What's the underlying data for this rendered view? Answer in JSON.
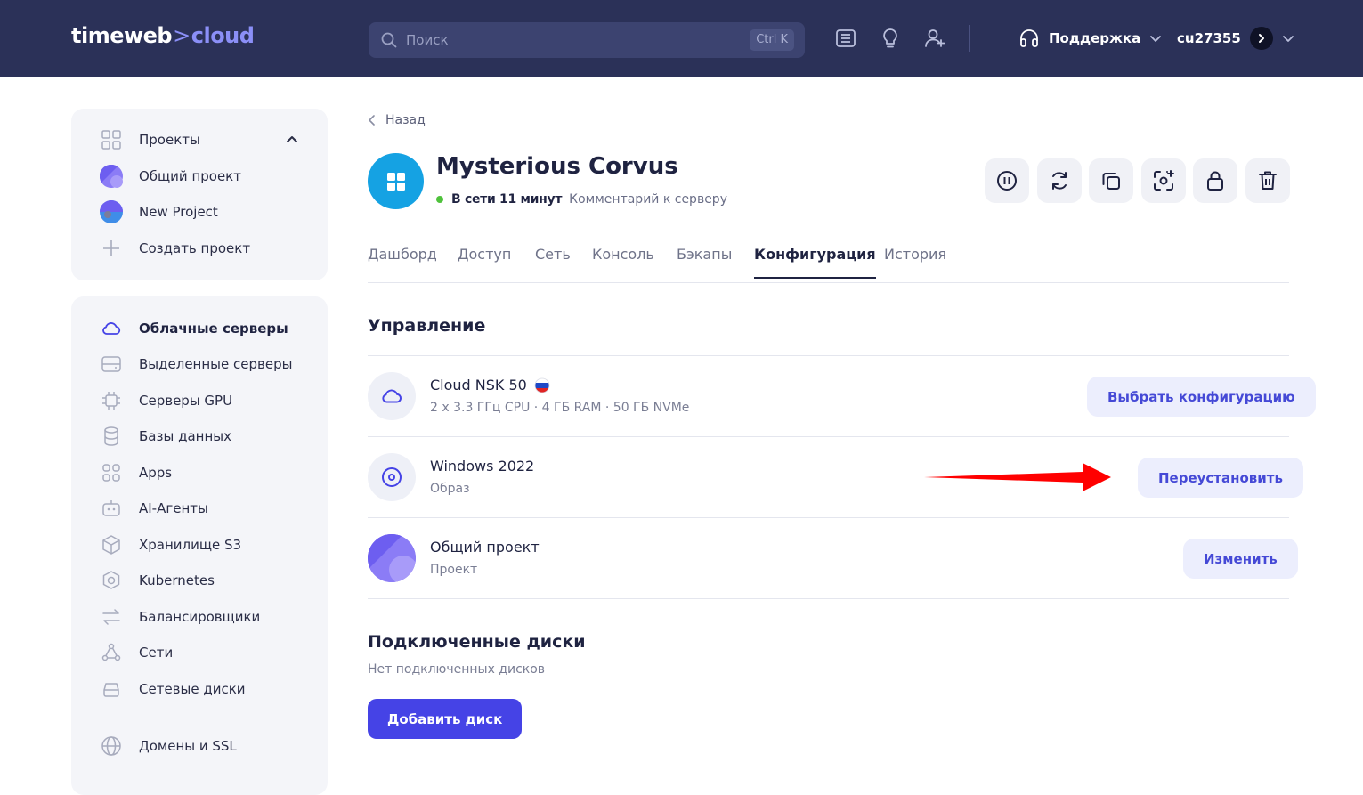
{
  "header": {
    "logo_left": "timeweb",
    "logo_sep": ">",
    "logo_right": "cloud",
    "search_placeholder": "Поиск",
    "search_shortcut": "Ctrl K",
    "support_label": "Поддержка",
    "account_label": "cu27355"
  },
  "sidebar": {
    "projects_header": "Проекты",
    "projects": [
      {
        "label": "Общий проект"
      },
      {
        "label": "New Project"
      },
      {
        "label": "Создать проект"
      }
    ],
    "items": [
      {
        "label": "Облачные серверы",
        "icon": "cloud-icon"
      },
      {
        "label": "Выделенные серверы",
        "icon": "server-icon"
      },
      {
        "label": "Серверы GPU",
        "icon": "chip-icon"
      },
      {
        "label": "Базы данных",
        "icon": "database-icon"
      },
      {
        "label": "Apps",
        "icon": "apps-icon"
      },
      {
        "label": "AI-Агенты",
        "icon": "bot-icon"
      },
      {
        "label": "Хранилище S3",
        "icon": "cube-icon"
      },
      {
        "label": "Kubernetes",
        "icon": "kubernetes-icon"
      },
      {
        "label": "Балансировщики",
        "icon": "arrows-icon"
      },
      {
        "label": "Сети",
        "icon": "network-icon"
      },
      {
        "label": "Сетевые диски",
        "icon": "disk-icon"
      },
      {
        "label": "Домены и SSL",
        "icon": "globe-icon"
      }
    ]
  },
  "main": {
    "back_label": "Назад",
    "server_name": "Mysterious Corvus",
    "status_text": "В сети 11 минут",
    "comment_link": "Комментарий к серверу",
    "tabs": [
      {
        "label": "Дашборд"
      },
      {
        "label": "Доступ"
      },
      {
        "label": "Сеть"
      },
      {
        "label": "Консоль"
      },
      {
        "label": "Бэкапы"
      },
      {
        "label": "Конфигурация"
      },
      {
        "label": "История"
      }
    ],
    "management_title": "Управление",
    "config": {
      "title": "Cloud NSK 50",
      "specs": "2 x 3.3 ГГц CPU · 4 ГБ RAM · 50 ГБ NVMe",
      "button": "Выбрать конфигурацию"
    },
    "image": {
      "title": "Windows 2022",
      "subtitle": "Образ",
      "button": "Переустановить"
    },
    "project": {
      "title": "Общий проект",
      "subtitle": "Проект",
      "button": "Изменить"
    },
    "disks_title": "Подключенные диски",
    "no_disks": "Нет подключенных дисков",
    "add_disk_button": "Добавить диск"
  },
  "colors": {
    "topbar": "#2b3158",
    "accent": "#4543e6",
    "status_online": "#4fc23c",
    "annotation_arrow": "#ff0000"
  }
}
